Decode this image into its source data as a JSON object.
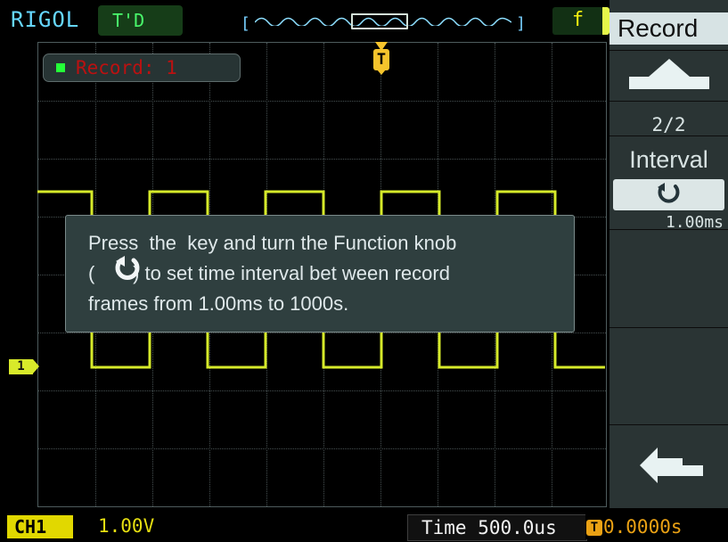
{
  "top": {
    "brand": "RIGOL",
    "status": "T'D",
    "trigger_mode": "f"
  },
  "screen": {
    "record_label": "Record: 1",
    "trigger_marker": "T",
    "channel_marker": "1"
  },
  "info_box": {
    "line1": "Press  the  key and turn the Function knob",
    "line2": "(       ) to set time interval bet ween record",
    "line3": "frames from 1.00ms to 1000s."
  },
  "menu": {
    "title": "Record",
    "page": "2/2",
    "item": "Interval",
    "value": "1.00ms"
  },
  "bottom": {
    "channel": "CH1",
    "voltage": "1.00V",
    "time": "Time 500.0us",
    "delay": "0.0000s"
  },
  "colors": {
    "trace": "#d6ea2a",
    "brand": "#66d7ff",
    "trigger": "#f6c42c",
    "record": "#bb1111"
  },
  "icons": {
    "knob": "function-knob-icon",
    "up": "up-arrow-icon",
    "back": "back-arrow-icon",
    "trigger": "trigger-marker-icon"
  }
}
